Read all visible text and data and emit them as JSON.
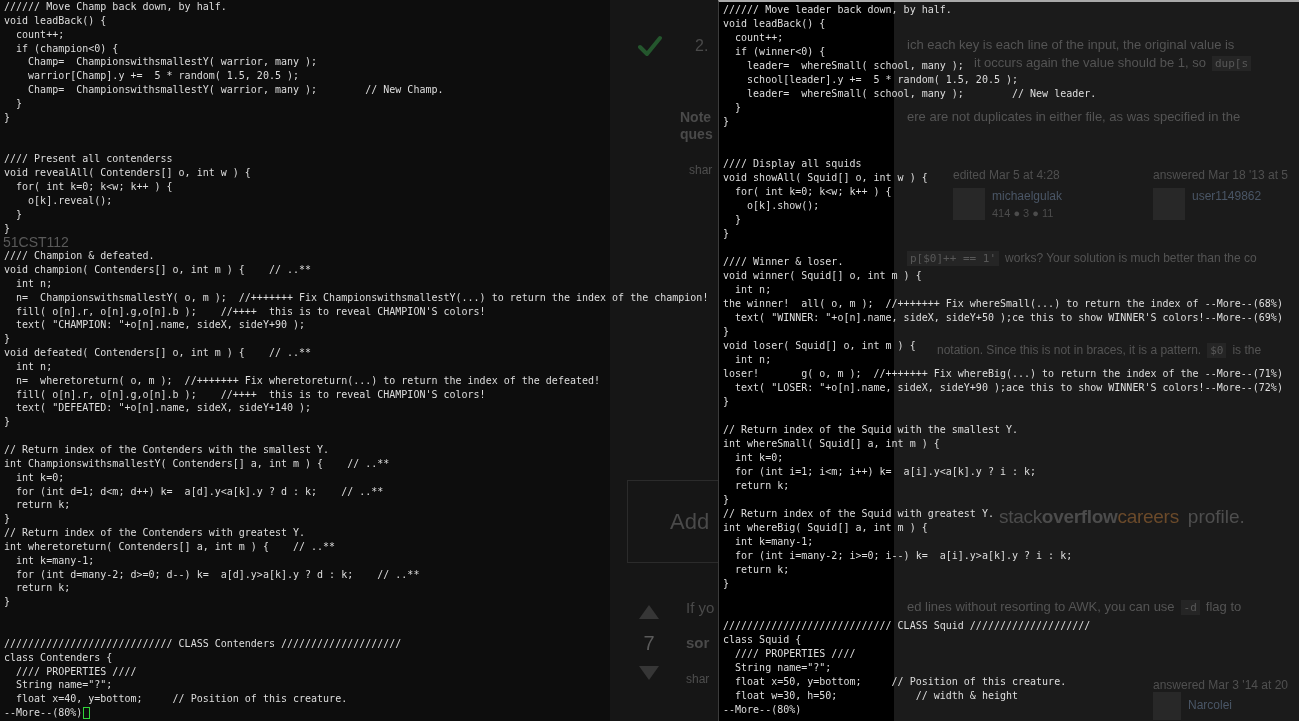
{
  "terminals": [
    {
      "lines": [
        {
          "kind": "code",
          "text": "////// Move Champ back down, by half."
        },
        {
          "kind": "code",
          "text": "void leadBack() {"
        },
        {
          "kind": "code",
          "text": "  count++;"
        },
        {
          "kind": "code",
          "text": "  if (champion<0) {"
        },
        {
          "kind": "code",
          "text": "    Champ=  ChampionswithsmallestY( warrior, many );"
        },
        {
          "kind": "code",
          "text": "    warrior[Champ].y +=  5 * random( 1.5, 20.5 );"
        },
        {
          "kind": "code",
          "text": "    Champ=  ChampionswithsmallestY( warrior, many );        // New Champ."
        },
        {
          "kind": "code",
          "text": "  }"
        },
        {
          "kind": "code",
          "text": "}"
        },
        {
          "kind": "blank"
        },
        {
          "kind": "blank"
        },
        {
          "kind": "code",
          "text": "//// Present all contenderss"
        },
        {
          "kind": "code",
          "text": "void revealAll( Contenders[] o, int w ) {"
        },
        {
          "kind": "code",
          "text": "  for( int k=0; k<w; k++ ) {"
        },
        {
          "kind": "code",
          "text": "    o[k].reveal();"
        },
        {
          "kind": "code",
          "text": "  }"
        },
        {
          "kind": "code",
          "text": "}"
        },
        {
          "kind": "blank"
        },
        {
          "kind": "code",
          "text": "//// Champion & defeated."
        },
        {
          "kind": "code",
          "text": "void champion( Contenders[] o, int m ) {    // ..**"
        },
        {
          "kind": "code",
          "text": "  int n;"
        },
        {
          "kind": "code",
          "text": "  n=  ChampionswithsmallestY( o, m );  //+++++++ Fix ChampionswithsmallestY(...) to return the index of the champion!"
        },
        {
          "kind": "code",
          "text": "  fill( o[n].r, o[n].g,o[n].b );    //++++  this is to reveal CHAMPION'S colors!"
        },
        {
          "kind": "code",
          "text": "  text( \"CHAMPION: \"+o[n].name, sideX, sideY+90 );"
        },
        {
          "kind": "code",
          "text": "}"
        },
        {
          "kind": "code",
          "text": "void defeated( Contenders[] o, int m ) {    // ..**"
        },
        {
          "kind": "code",
          "text": "  int n;"
        },
        {
          "kind": "code",
          "text": "  n=  wheretoreturn( o, m );  //+++++++ Fix wheretoreturn(...) to return the index of the defeated!"
        },
        {
          "kind": "code",
          "text": "  fill( o[n].r, o[n].g,o[n].b );    //++++  this is to reveal CHAMPION'S colors!"
        },
        {
          "kind": "code",
          "text": "  text( \"DEFEATED: \"+o[n].name, sideX, sideY+140 );"
        },
        {
          "kind": "code",
          "text": "}"
        },
        {
          "kind": "blank"
        },
        {
          "kind": "code",
          "text": "// Return index of the Contenders with the smallest Y."
        },
        {
          "kind": "code",
          "text": "int ChampionswithsmallestY( Contenders[] a, int m ) {    // ..**"
        },
        {
          "kind": "code",
          "text": "  int k=0;"
        },
        {
          "kind": "code",
          "text": "  for (int d=1; d<m; d++) k=  a[d].y<a[k].y ? d : k;    // ..**"
        },
        {
          "kind": "code",
          "text": "  return k;"
        },
        {
          "kind": "code",
          "text": "}"
        },
        {
          "kind": "code",
          "text": "// Return index of the Contenders with greatest Y."
        },
        {
          "kind": "code",
          "text": "int wheretoreturn( Contenders[] a, int m ) {    // ..**"
        },
        {
          "kind": "code",
          "text": "  int k=many-1;"
        },
        {
          "kind": "code",
          "text": "  for (int d=many-2; d>=0; d--) k=  a[d].y>a[k].y ? d : k;    // ..**"
        },
        {
          "kind": "code",
          "text": "  return k;"
        },
        {
          "kind": "code",
          "text": "}"
        },
        {
          "kind": "blank"
        },
        {
          "kind": "blank"
        },
        {
          "kind": "code",
          "text": "//////////////////////////// CLASS Contenders ////////////////////"
        },
        {
          "kind": "code",
          "text": "class Contenders {"
        },
        {
          "kind": "code",
          "text": "  //// PROPERTIES ////"
        },
        {
          "kind": "code",
          "text": "  String name=\"?\";"
        },
        {
          "kind": "code",
          "text": "  float x=40, y=bottom;     // Position of this creature."
        },
        {
          "kind": "pager",
          "text": "--More--(80%)",
          "cursor": true
        }
      ],
      "page_behind": {
        "kind": "sheet",
        "sheet_title": "51CST112",
        "accepted": true,
        "answer_number": "2.",
        "note_lines": [
          "Note",
          "ques"
        ],
        "share_top": "shar",
        "add_button": "Add",
        "vote_count": "7",
        "answer_lines": [
          "If yo",
          "sor"
        ],
        "share_bottom": "shar"
      }
    },
    {
      "lines": [
        {
          "kind": "code",
          "text": "////// Move leader back down, by half."
        },
        {
          "kind": "code",
          "text": "void leadBack() {"
        },
        {
          "kind": "code",
          "text": "  count++;"
        },
        {
          "kind": "code",
          "text": "  if (winner<0) {"
        },
        {
          "kind": "code",
          "text": "    leader=  whereSmall( school, many );"
        },
        {
          "kind": "code",
          "text": "    school[leader].y +=  5 * random( 1.5, 20.5 );"
        },
        {
          "kind": "code",
          "text": "    leader=  whereSmall( school, many );        // New leader."
        },
        {
          "kind": "code",
          "text": "  }"
        },
        {
          "kind": "code",
          "text": "}"
        },
        {
          "kind": "blank"
        },
        {
          "kind": "blank"
        },
        {
          "kind": "code",
          "text": "//// Display all squids"
        },
        {
          "kind": "code",
          "text": "void showAll( Squid[] o, int w ) {"
        },
        {
          "kind": "code",
          "text": "  for( int k=0; k<w; k++ ) {"
        },
        {
          "kind": "code",
          "text": "    o[k].show();"
        },
        {
          "kind": "code",
          "text": "  }"
        },
        {
          "kind": "code",
          "text": "}"
        },
        {
          "kind": "blank"
        },
        {
          "kind": "code",
          "text": "//// Winner & loser."
        },
        {
          "kind": "code",
          "text": "void winner( Squid[] o, int m ) {"
        },
        {
          "kind": "code",
          "text": "  int n;"
        },
        {
          "kind": "code",
          "text": "the winner!  all( o, m );  //+++++++ Fix whereSmall(...) to return the index of --More--(68%)"
        },
        {
          "kind": "code",
          "text": "  text( \"WINNER: \"+o[n].name, sideX, sideY+50 );ce this to show WINNER'S colors!--More--(69%)"
        },
        {
          "kind": "code",
          "text": "}"
        },
        {
          "kind": "code",
          "text": "void loser( Squid[] o, int m ) {"
        },
        {
          "kind": "code",
          "text": "  int n;"
        },
        {
          "kind": "code",
          "text": "loser!       g( o, m );  //+++++++ Fix whereBig(...) to return the index of the --More--(71%)"
        },
        {
          "kind": "code",
          "text": "  text( \"LOSER: \"+o[n].name, sideX, sideY+90 );ace this to show WINNER'S colors!--More--(72%)"
        },
        {
          "kind": "code",
          "text": "}"
        },
        {
          "kind": "blank"
        },
        {
          "kind": "code",
          "text": "// Return index of the Squid with the smallest Y."
        },
        {
          "kind": "code",
          "text": "int whereSmall( Squid[] a, int m ) {"
        },
        {
          "kind": "code",
          "text": "  int k=0;"
        },
        {
          "kind": "code",
          "text": "  for (int i=1; i<m; i++) k=  a[i].y<a[k].y ? i : k;"
        },
        {
          "kind": "code",
          "text": "  return k;"
        },
        {
          "kind": "code",
          "text": "}"
        },
        {
          "kind": "code",
          "text": "// Return index of the Squid with greatest Y."
        },
        {
          "kind": "code",
          "text": "int whereBig( Squid[] a, int m ) {"
        },
        {
          "kind": "code",
          "text": "  int k=many-1;"
        },
        {
          "kind": "code",
          "text": "  for (int i=many-2; i>=0; i--) k=  a[i].y>a[k].y ? i : k;"
        },
        {
          "kind": "code",
          "text": "  return k;"
        },
        {
          "kind": "code",
          "text": "}"
        },
        {
          "kind": "blank"
        },
        {
          "kind": "blank"
        },
        {
          "kind": "code",
          "text": "//////////////////////////// CLASS Squid ////////////////////"
        },
        {
          "kind": "code",
          "text": "class Squid {"
        },
        {
          "kind": "code",
          "text": "  //// PROPERTIES ////"
        },
        {
          "kind": "code",
          "text": "  String name=\"?\";"
        },
        {
          "kind": "code",
          "text": "  float x=50, y=bottom;     // Position of this creature."
        },
        {
          "kind": "code",
          "text": "  float w=30, h=50;             // width & height"
        },
        {
          "kind": "pager",
          "text": "--More--(80%)",
          "cursor": false
        }
      ],
      "page_behind": {
        "kind": "page",
        "post_lines": [
          {
            "parts": [
              {
                "kind": "prose",
                "text": "ich each key is each line of the input, the original value is"
              }
            ]
          },
          {
            "parts": [
              {
                "kind": "prose",
                "text": "it occurs again the value should be 1, so"
              },
              {
                "kind": "code",
                "text": "dup[s"
              }
            ]
          },
          {
            "parts": [
              {
                "kind": "prose",
                "text": "ere are not duplicates in either file, as was specified in the"
              }
            ]
          }
        ],
        "signatures": [
          {
            "action": "edited Mar 5 at 4:28",
            "user": "michaelgulak",
            "reputation": "414 ● 3 ● 11"
          },
          {
            "action": "answered Mar 18 '13 at 5",
            "user": "user1149862"
          }
        ],
        "comments": [
          {
            "parts": [
              {
                "kind": "code",
                "text": "p[$0]++ == 1'"
              },
              {
                "kind": "prose",
                "text": "works? Your solution is much better than the co"
              }
            ]
          },
          {
            "parts": [
              {
                "kind": "prose",
                "text": "notation. Since this is not in braces, it is a pattern."
              },
              {
                "kind": "code",
                "text": "$0"
              },
              {
                "kind": "prose",
                "text": "is the"
              }
            ]
          }
        ],
        "banner": {
          "wordmark": [
            {
              "kind": "light",
              "text": "stack"
            },
            {
              "kind": "bold",
              "text": "overflow"
            },
            {
              "kind": "accent",
              "text": "careers"
            }
          ],
          "tagline": "profile."
        },
        "second_answer": {
          "parts": [
            {
              "kind": "prose",
              "text": "ed lines without resorting to AWK, you can use"
            },
            {
              "kind": "code",
              "text": "-d"
            },
            {
              "kind": "prose",
              "text": "flag to"
            }
          ],
          "action": "answered Mar 3 '14 at 20",
          "user": "Narcolei"
        }
      }
    }
  ]
}
